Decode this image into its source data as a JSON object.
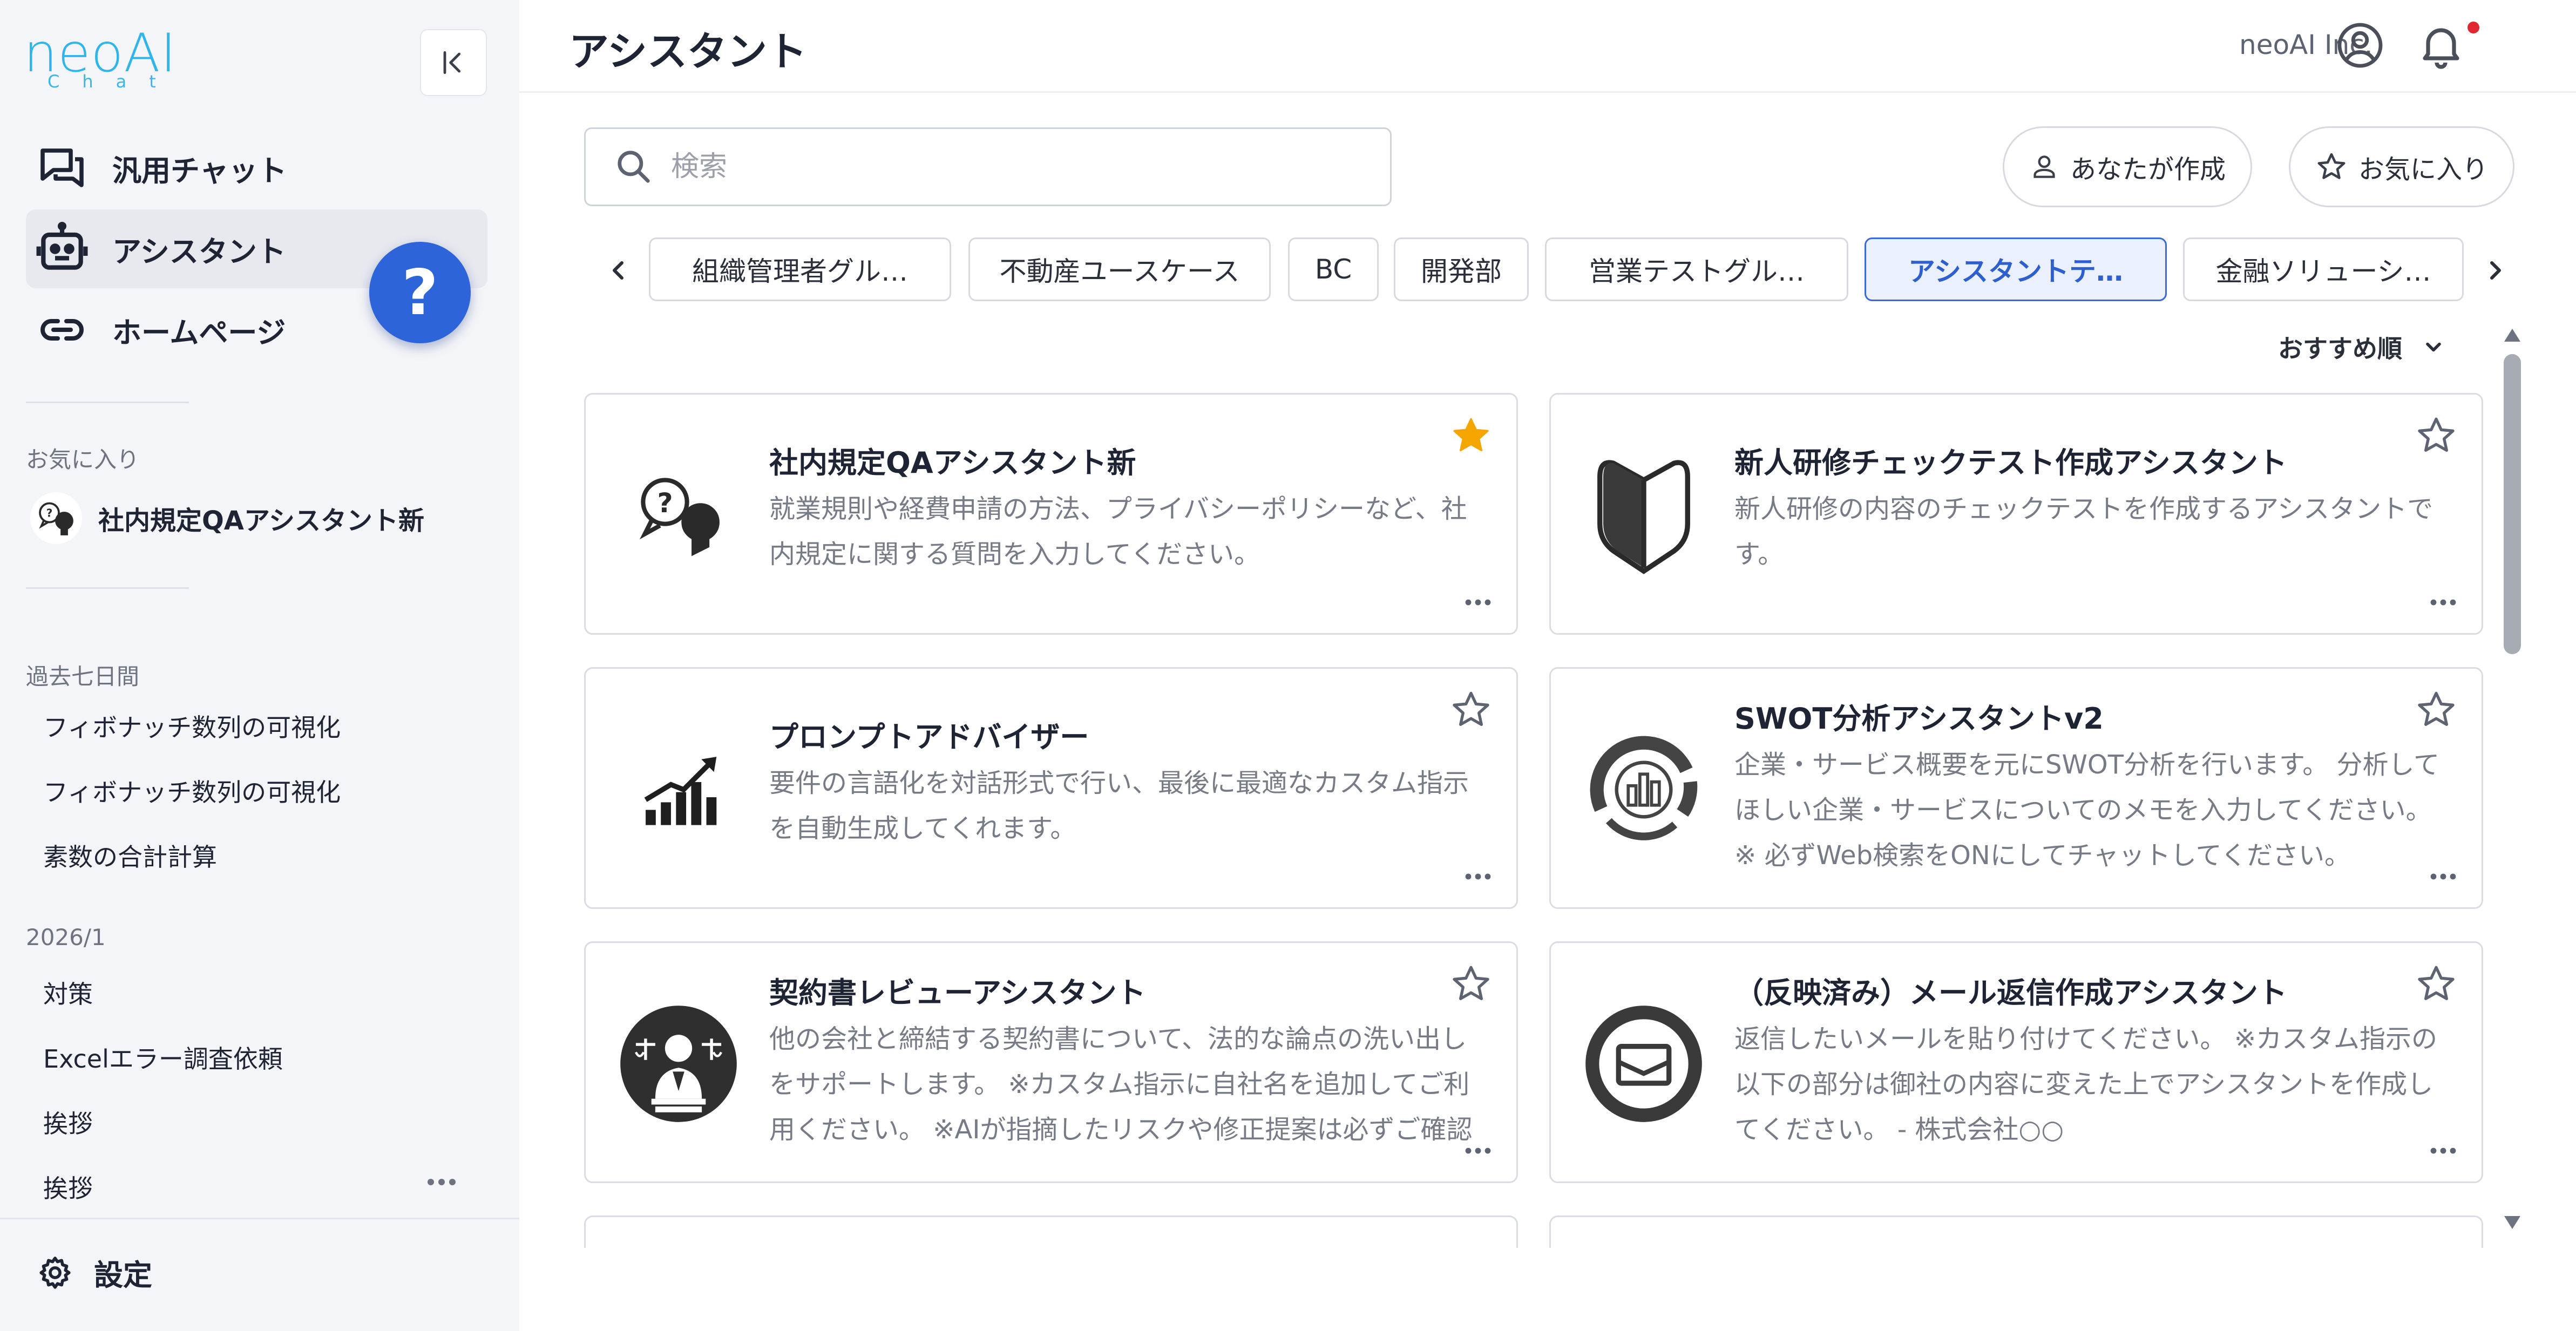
{
  "app": {
    "logo_text": "neoAI",
    "logo_sub": "Chat"
  },
  "sidebar": {
    "nav": [
      {
        "label": "汎用チャット",
        "icon": "chat-icon"
      },
      {
        "label": "アシスタント",
        "icon": "robot-icon",
        "active": true
      },
      {
        "label": "ホームページ",
        "icon": "link-icon"
      }
    ],
    "help_label": "?",
    "favorites_title": "お気に入り",
    "favorites": [
      {
        "label": "社内規定QAアシスタント新",
        "icon": "qa-bubbles-icon"
      }
    ],
    "history_sections": [
      {
        "title": "過去七日間",
        "items": [
          "フィボナッチ数列の可視化",
          "フィボナッチ数列の可視化",
          "素数の合計計算"
        ]
      },
      {
        "title": "2026/1",
        "items": [
          "対策",
          "Excelエラー調査依頼",
          "挨拶",
          "挨拶"
        ]
      }
    ],
    "settings_label": "設定"
  },
  "header": {
    "title": "アシスタント",
    "org": "neoAI Inc.",
    "has_notification": true
  },
  "search": {
    "placeholder": "検索",
    "value": ""
  },
  "filters": {
    "created_by_you": "あなたが作成",
    "favorites": "お気に入り"
  },
  "tabs": [
    {
      "label": "組織管理者グル…"
    },
    {
      "label": "不動産ユースケース"
    },
    {
      "label": "BC"
    },
    {
      "label": "開発部"
    },
    {
      "label": "営業テストグル…"
    },
    {
      "label": "アシスタントテ…",
      "active": true
    },
    {
      "label": "金融ソリューシ…"
    }
  ],
  "sort": {
    "label": "おすすめ順"
  },
  "cards": [
    {
      "title": "社内規定QAアシスタント新",
      "description": "就業規則や経費申請の方法、プライバシーポリシーなど、社内規定に関する質問を入力してください。",
      "favorited": true,
      "icon": "qa-bubbles-icon"
    },
    {
      "title": "新人研修チェックテスト作成アシスタント",
      "description": "新人研修の内容のチェックテストを作成するアシスタントです。",
      "favorited": false,
      "icon": "beginner-mark-icon"
    },
    {
      "title": "プロンプトアドバイザー",
      "description": "要件の言語化を対話形式で行い、最後に最適なカスタム指示を自動生成してくれます。",
      "favorited": false,
      "icon": "growth-chart-icon"
    },
    {
      "title": "SWOT分析アシスタントv2",
      "description": "企業・サービス概要を元にSWOT分析を行います。 分析してほしい企業・サービスについてのメモを入力してください。 ※ 必ずWeb検索をONにしてチャットしてください。",
      "favorited": false,
      "icon": "analytics-ring-icon"
    },
    {
      "title": "契約書レビューアシスタント",
      "description": "他の会社と締結する契約書について、法的な論点の洗い出しをサポートします。 ※カスタム指示に自社名を追加してご利用ください。 ※AIが指摘したリスクや修正提案は必ずご確認ください。",
      "favorited": false,
      "icon": "lawyer-icon"
    },
    {
      "title": "（反映済み）メール返信作成アシスタント",
      "description": "返信したいメールを貼り付けてください。 ※カスタム指示の以下の部分は御社の内容に変えた上でアシスタントを作成してください。 - 株式会社○○",
      "favorited": false,
      "icon": "mail-icon"
    }
  ],
  "colors": {
    "accent": "#2e64da",
    "active_tab_bg": "#eaf0fd",
    "star_filled": "#f5a500",
    "notification": "#e0262f",
    "logo": "#2fb5e8"
  }
}
